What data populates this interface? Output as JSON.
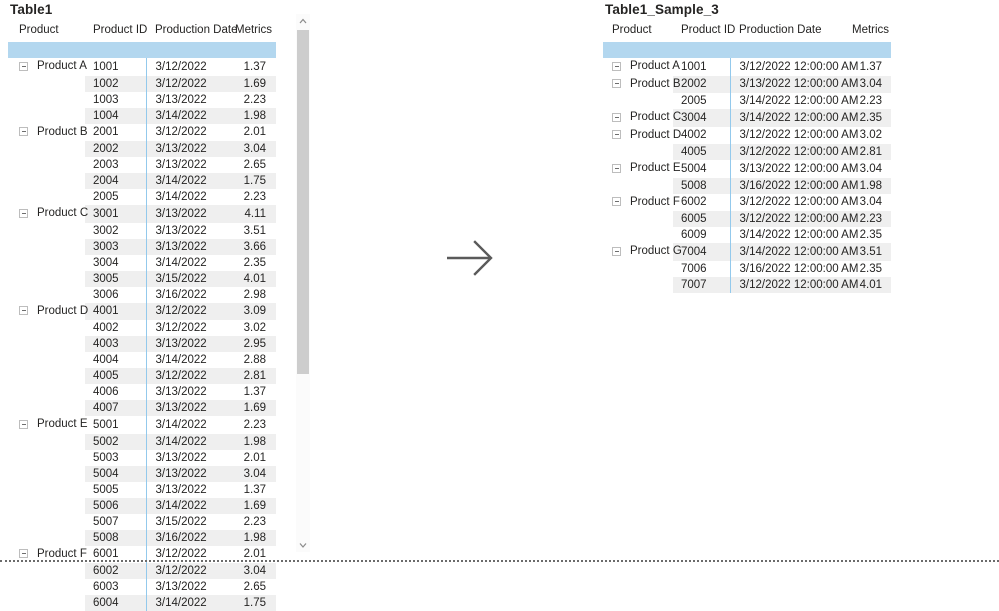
{
  "left_table": {
    "title": "Table1",
    "columns": [
      "Product",
      "Product ID",
      "Production Date",
      "Metrics"
    ],
    "rows": [
      {
        "product": "Product A",
        "expander": true,
        "id": "1001",
        "date": "3/12/2022",
        "metric": "1.37"
      },
      {
        "product": "",
        "expander": false,
        "id": "1002",
        "date": "3/12/2022",
        "metric": "1.69"
      },
      {
        "product": "",
        "expander": false,
        "id": "1003",
        "date": "3/13/2022",
        "metric": "2.23"
      },
      {
        "product": "",
        "expander": false,
        "id": "1004",
        "date": "3/14/2022",
        "metric": "1.98"
      },
      {
        "product": "Product B",
        "expander": true,
        "id": "2001",
        "date": "3/12/2022",
        "metric": "2.01"
      },
      {
        "product": "",
        "expander": false,
        "id": "2002",
        "date": "3/13/2022",
        "metric": "3.04"
      },
      {
        "product": "",
        "expander": false,
        "id": "2003",
        "date": "3/13/2022",
        "metric": "2.65"
      },
      {
        "product": "",
        "expander": false,
        "id": "2004",
        "date": "3/14/2022",
        "metric": "1.75"
      },
      {
        "product": "",
        "expander": false,
        "id": "2005",
        "date": "3/14/2022",
        "metric": "2.23"
      },
      {
        "product": "Product C",
        "expander": true,
        "id": "3001",
        "date": "3/13/2022",
        "metric": "4.11"
      },
      {
        "product": "",
        "expander": false,
        "id": "3002",
        "date": "3/13/2022",
        "metric": "3.51"
      },
      {
        "product": "",
        "expander": false,
        "id": "3003",
        "date": "3/13/2022",
        "metric": "3.66"
      },
      {
        "product": "",
        "expander": false,
        "id": "3004",
        "date": "3/14/2022",
        "metric": "2.35"
      },
      {
        "product": "",
        "expander": false,
        "id": "3005",
        "date": "3/15/2022",
        "metric": "4.01"
      },
      {
        "product": "",
        "expander": false,
        "id": "3006",
        "date": "3/16/2022",
        "metric": "2.98"
      },
      {
        "product": "Product D",
        "expander": true,
        "id": "4001",
        "date": "3/12/2022",
        "metric": "3.09"
      },
      {
        "product": "",
        "expander": false,
        "id": "4002",
        "date": "3/12/2022",
        "metric": "3.02"
      },
      {
        "product": "",
        "expander": false,
        "id": "4003",
        "date": "3/13/2022",
        "metric": "2.95"
      },
      {
        "product": "",
        "expander": false,
        "id": "4004",
        "date": "3/14/2022",
        "metric": "2.88"
      },
      {
        "product": "",
        "expander": false,
        "id": "4005",
        "date": "3/12/2022",
        "metric": "2.81"
      },
      {
        "product": "",
        "expander": false,
        "id": "4006",
        "date": "3/13/2022",
        "metric": "1.37"
      },
      {
        "product": "",
        "expander": false,
        "id": "4007",
        "date": "3/13/2022",
        "metric": "1.69"
      },
      {
        "product": "Product E",
        "expander": true,
        "id": "5001",
        "date": "3/14/2022",
        "metric": "2.23"
      },
      {
        "product": "",
        "expander": false,
        "id": "5002",
        "date": "3/14/2022",
        "metric": "1.98"
      },
      {
        "product": "",
        "expander": false,
        "id": "5003",
        "date": "3/13/2022",
        "metric": "2.01"
      },
      {
        "product": "",
        "expander": false,
        "id": "5004",
        "date": "3/13/2022",
        "metric": "3.04"
      },
      {
        "product": "",
        "expander": false,
        "id": "5005",
        "date": "3/13/2022",
        "metric": "1.37"
      },
      {
        "product": "",
        "expander": false,
        "id": "5006",
        "date": "3/14/2022",
        "metric": "1.69"
      },
      {
        "product": "",
        "expander": false,
        "id": "5007",
        "date": "3/15/2022",
        "metric": "2.23"
      },
      {
        "product": "",
        "expander": false,
        "id": "5008",
        "date": "3/16/2022",
        "metric": "1.98"
      },
      {
        "product": "Product F",
        "expander": true,
        "id": "6001",
        "date": "3/12/2022",
        "metric": "2.01"
      },
      {
        "product": "",
        "expander": false,
        "id": "6002",
        "date": "3/12/2022",
        "metric": "3.04"
      },
      {
        "product": "",
        "expander": false,
        "id": "6003",
        "date": "3/13/2022",
        "metric": "2.65"
      },
      {
        "product": "",
        "expander": false,
        "id": "6004",
        "date": "3/14/2022",
        "metric": "1.75"
      }
    ]
  },
  "right_table": {
    "title": "Table1_Sample_3",
    "columns": [
      "Product",
      "Product ID",
      "Production Date",
      "Metrics"
    ],
    "rows": [
      {
        "product": "Product A",
        "expander": true,
        "id": "1001",
        "date": "3/12/2022 12:00:00 AM",
        "metric": "1.37"
      },
      {
        "product": "Product B",
        "expander": true,
        "id": "2002",
        "date": "3/13/2022 12:00:00 AM",
        "metric": "3.04"
      },
      {
        "product": "",
        "expander": false,
        "id": "2005",
        "date": "3/14/2022 12:00:00 AM",
        "metric": "2.23"
      },
      {
        "product": "Product C",
        "expander": true,
        "id": "3004",
        "date": "3/14/2022 12:00:00 AM",
        "metric": "2.35"
      },
      {
        "product": "Product D",
        "expander": true,
        "id": "4002",
        "date": "3/12/2022 12:00:00 AM",
        "metric": "3.02"
      },
      {
        "product": "",
        "expander": false,
        "id": "4005",
        "date": "3/12/2022 12:00:00 AM",
        "metric": "2.81"
      },
      {
        "product": "Product E",
        "expander": true,
        "id": "5004",
        "date": "3/13/2022 12:00:00 AM",
        "metric": "3.04"
      },
      {
        "product": "",
        "expander": false,
        "id": "5008",
        "date": "3/16/2022 12:00:00 AM",
        "metric": "1.98"
      },
      {
        "product": "Product F",
        "expander": true,
        "id": "6002",
        "date": "3/12/2022 12:00:00 AM",
        "metric": "3.04"
      },
      {
        "product": "",
        "expander": false,
        "id": "6005",
        "date": "3/12/2022 12:00:00 AM",
        "metric": "2.23"
      },
      {
        "product": "",
        "expander": false,
        "id": "6009",
        "date": "3/14/2022 12:00:00 AM",
        "metric": "2.35"
      },
      {
        "product": "Product G",
        "expander": true,
        "id": "7004",
        "date": "3/14/2022 12:00:00 AM",
        "metric": "3.51"
      },
      {
        "product": "",
        "expander": false,
        "id": "7006",
        "date": "3/16/2022 12:00:00 AM",
        "metric": "2.35"
      },
      {
        "product": "",
        "expander": false,
        "id": "7007",
        "date": "3/12/2022 12:00:00 AM",
        "metric": "4.01"
      }
    ]
  },
  "flow_arrow": {
    "icon": "arrow-right-icon"
  },
  "scrollbar": {
    "up_icon": "chevron-up-icon",
    "down_icon": "chevron-down-icon"
  },
  "colors": {
    "header_rule": "#b3d7ef",
    "column_separator": "#93c9ec",
    "stripe": "#efefef",
    "text": "#252423",
    "arrow": "#5a5a5a",
    "scroll_thumb": "#cdcdcd"
  }
}
